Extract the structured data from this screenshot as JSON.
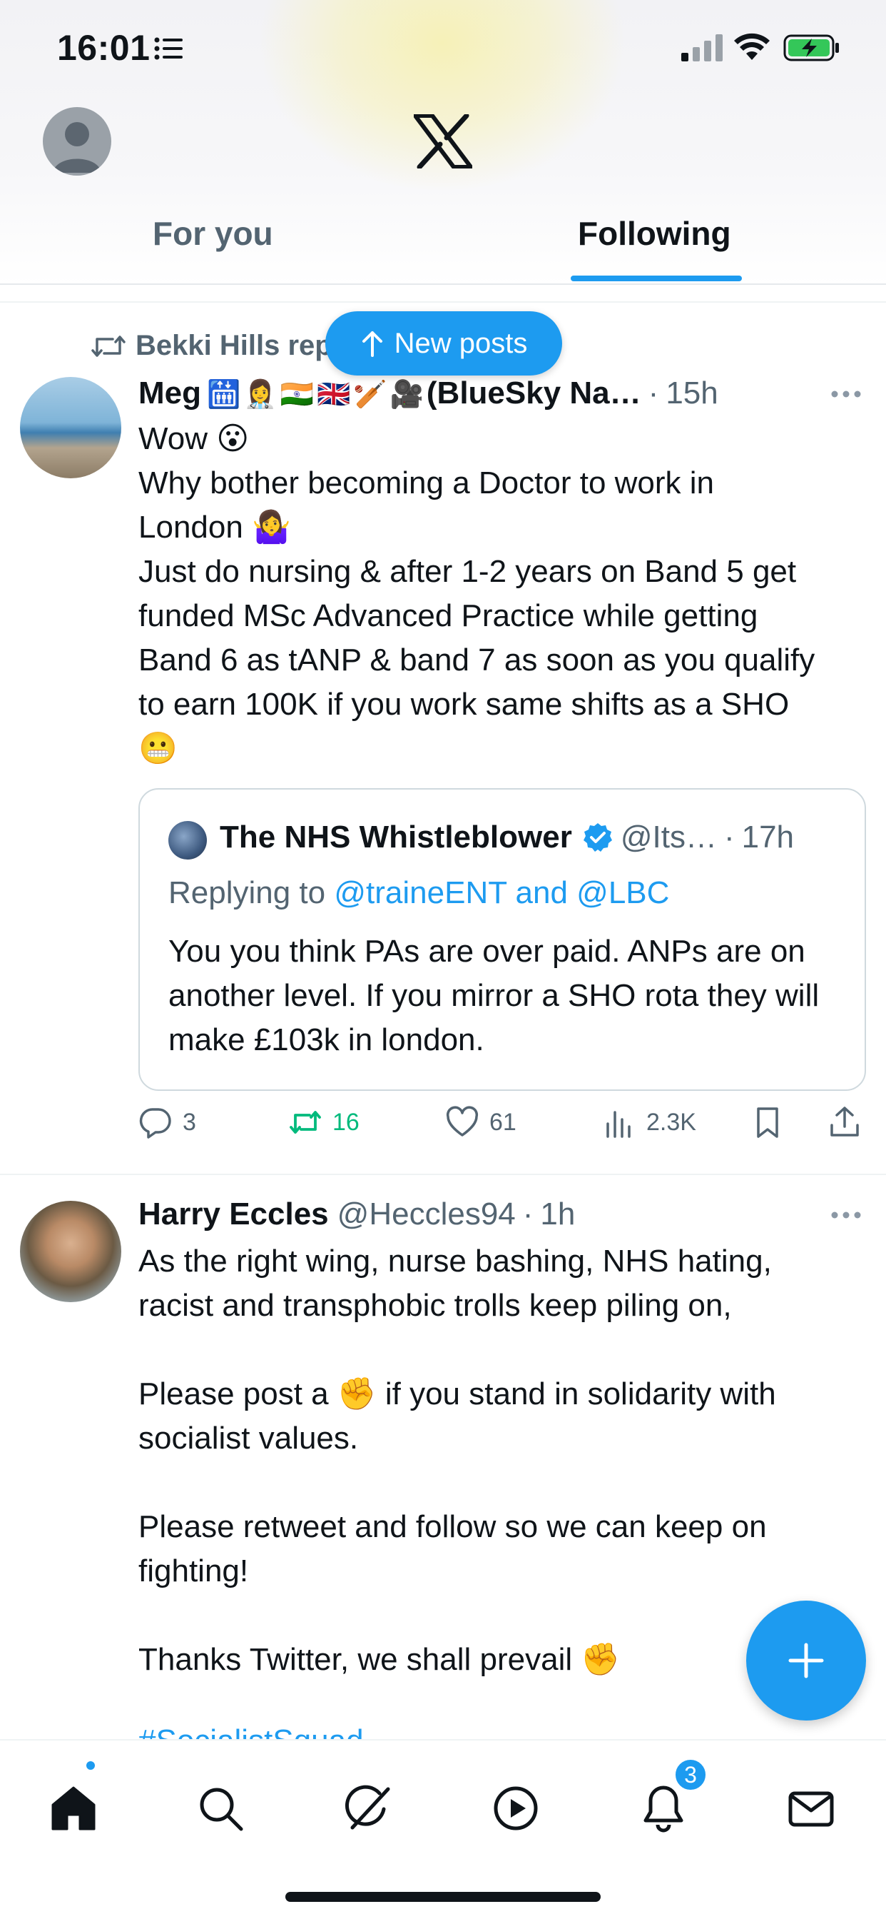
{
  "status_bar": {
    "time": "16:01"
  },
  "header": {
    "tabs": [
      {
        "label": "For you",
        "active": false
      },
      {
        "label": "Following",
        "active": true
      }
    ],
    "new_posts_label": "New posts"
  },
  "posts": [
    {
      "repost_by": "Bekki Hills reposted",
      "author_name": "Meg",
      "author_emojis": "🛗👩‍⚕️🇮🇳🇬🇧🏏🎥",
      "author_suffix": "(BlueSky Na…",
      "time": "15h",
      "text_lines": [
        "Wow 😮",
        "Why bother becoming a Doctor to work in",
        "London 🤷‍♀️",
        "Just do nursing & after 1-2 years on Band 5 get",
        "funded MSc Advanced Practice while getting",
        "Band 6 as tANP & band 7 as soon as you qualify",
        "to earn 100K if you work same shifts as a SHO",
        "😬"
      ],
      "quote": {
        "author_name": "The NHS Whistleblower",
        "handle": "@Its…",
        "time": "17h",
        "reply_prefix": "Replying to ",
        "reply_links": "@traineENT and @LBC",
        "text": "You you think PAs are over paid. ANPs are on another level. If you mirror a SHO rota they will make £103k in london."
      },
      "stats": {
        "replies": "3",
        "reposts": "16",
        "likes": "61",
        "views": "2.3K"
      }
    },
    {
      "author_name": "Harry Eccles",
      "handle": "@Heccles94",
      "time": "1h",
      "text_lines": [
        "As the right wing, nurse bashing, NHS hating,",
        "racist and transphobic trolls keep piling on,",
        "",
        "Please post a ✊ if you stand in solidarity with",
        "socialist values.",
        "",
        "Please retweet and follow so we can keep on",
        "fighting!",
        "",
        "Thanks Twitter, we shall prevail ✊"
      ],
      "tags_partial": "#SocialistSquad"
    }
  ],
  "bottom_nav": {
    "items": [
      "home",
      "search",
      "grok",
      "video",
      "notifications",
      "messages"
    ],
    "notification_count": "3"
  },
  "colors": {
    "accent": "#1d9bf0",
    "repost_green": "#00ba7c",
    "text_secondary": "#536471"
  }
}
